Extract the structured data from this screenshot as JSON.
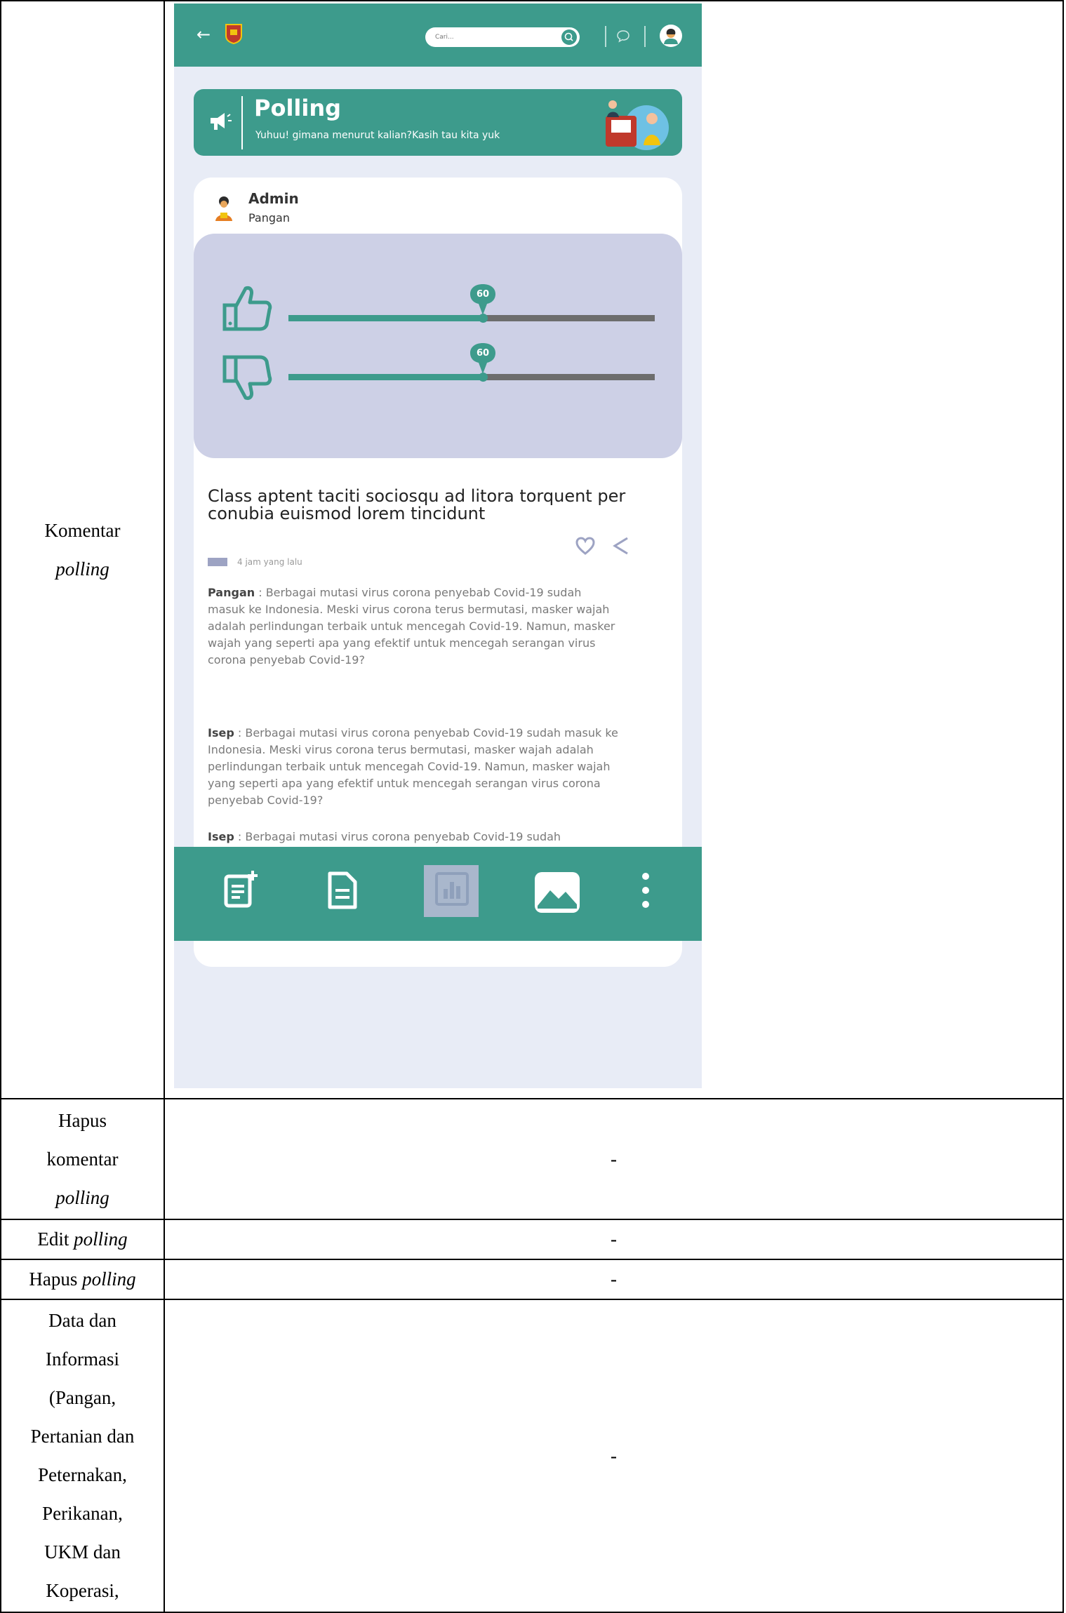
{
  "rows": [
    {
      "label": [
        "Komentar",
        "polling"
      ],
      "value": ""
    },
    {
      "label": [
        "Hapus",
        "komentar",
        "polling"
      ],
      "value": "-"
    },
    {
      "label": [
        "Edit",
        "polling"
      ],
      "value": "-"
    },
    {
      "label": [
        "Hapus",
        "polling"
      ],
      "value": "-"
    },
    {
      "label": [
        "Data dan",
        "Informasi",
        "(Pangan,",
        "Pertanian dan",
        "Peternakan,",
        "Perikanan,",
        "UKM dan",
        "Koperasi,"
      ],
      "value": "-"
    }
  ],
  "app": {
    "back_icon": "arrow-left-icon",
    "search_placeholder": "Cari...",
    "banner": {
      "title": "Polling",
      "subtitle": "Yuhuu! gimana menurut kalian?Kasih tau kita yuk"
    },
    "post": {
      "author": "Admin",
      "category": "Pangan",
      "poll": {
        "like_value": "60",
        "dislike_value": "60",
        "like_fraction": 0.53,
        "dislike_fraction": 0.53
      },
      "question": "Class aptent taciti sociosqu ad litora torquent per conubia euismod lorem tincidunt",
      "time": "4 jam yang lalu",
      "comments": [
        {
          "name": "Pangan",
          "text": " : Berbagai mutasi virus corona penyebab Covid-19 sudah masuk ke Indonesia. Meski virus corona terus bermutasi, masker wajah adalah perlindungan terbaik untuk mencegah Covid-19. Namun, masker wajah yang seperti apa yang efektif untuk mencegah serangan virus corona penyebab Covid-19?"
        },
        {
          "name": "Isep",
          "text": " : Berbagai mutasi virus corona penyebab Covid-19 sudah masuk ke Indonesia. Meski virus corona terus bermutasi, masker wajah adalah perlindungan terbaik untuk mencegah Covid-19. Namun, masker wajah yang seperti apa yang efektif untuk mencegah serangan virus corona penyebab Covid-19?"
        },
        {
          "name": "Isep",
          "text": " : Berbagai mutasi virus corona penyebab Covid-19 sudah"
        }
      ]
    },
    "toolbar": [
      "add-note-icon",
      "document-icon",
      "poll-chart-icon",
      "image-icon",
      "more-vertical-icon"
    ],
    "colors": {
      "primary": "#3d9b8c",
      "poll_bg": "#cdd0e6",
      "page_bg": "#e8ecf6"
    }
  }
}
